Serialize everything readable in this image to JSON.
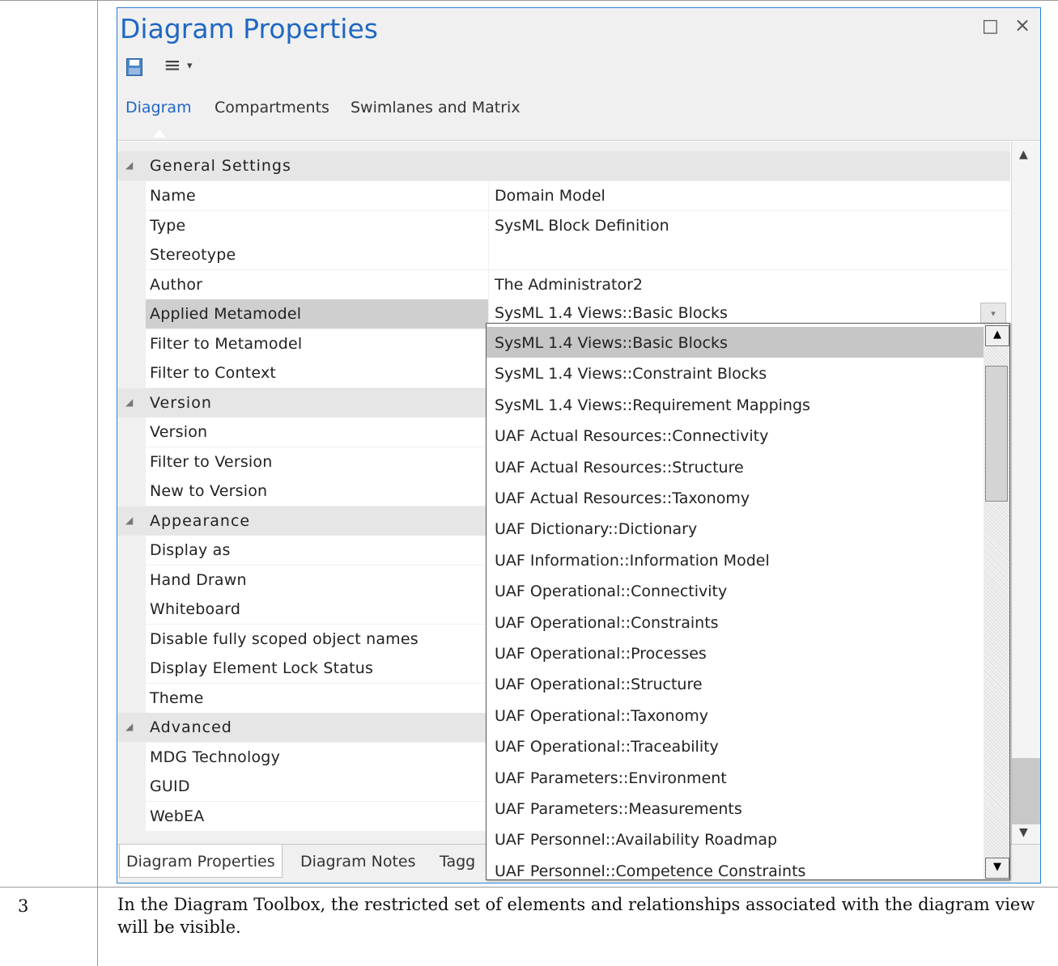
{
  "window": {
    "title": "Diagram Properties",
    "maximize_icon": "□",
    "close_icon": "×",
    "toolbar_menu_icon": "≡",
    "toolbar_caret": "▾"
  },
  "tabs": [
    "Diagram",
    "Compartments",
    "Swimlanes and Matrix"
  ],
  "grid": {
    "categories": {
      "general": "General Settings",
      "version": "Version",
      "appearance": "Appearance",
      "advanced": "Advanced"
    },
    "props": {
      "name": {
        "label": "Name",
        "value": "Domain Model"
      },
      "type": {
        "label": "Type",
        "value": "SysML Block Definition"
      },
      "stereotype": {
        "label": "Stereotype",
        "value": ""
      },
      "author": {
        "label": "Author",
        "value": "The Administrator2"
      },
      "applied_metamodel": {
        "label": "Applied Metamodel",
        "value": "SysML 1.4 Views::Basic Blocks"
      },
      "filter_metamodel": {
        "label": "Filter to Metamodel"
      },
      "filter_context": {
        "label": "Filter to Context"
      },
      "version": {
        "label": "Version"
      },
      "filter_version": {
        "label": "Filter to Version"
      },
      "new_version": {
        "label": "New to Version"
      },
      "display_as": {
        "label": "Display as"
      },
      "hand_drawn": {
        "label": "Hand Drawn"
      },
      "whiteboard": {
        "label": "Whiteboard"
      },
      "disable_scoped": {
        "label": "Disable fully scoped object names"
      },
      "lock_status": {
        "label": "Display Element Lock Status"
      },
      "theme": {
        "label": "Theme"
      },
      "mdg": {
        "label": "MDG Technology"
      },
      "guid": {
        "label": "GUID"
      },
      "webea": {
        "label": "WebEA"
      }
    }
  },
  "dropdown": {
    "options": [
      "SysML 1.4 Views::Basic Blocks",
      "SysML 1.4 Views::Constraint Blocks",
      "SysML 1.4 Views::Requirement Mappings",
      "UAF Actual Resources::Connectivity",
      "UAF Actual Resources::Structure",
      "UAF Actual Resources::Taxonomy",
      "UAF Dictionary::Dictionary",
      "UAF Information::Information Model",
      "UAF Operational::Connectivity",
      "UAF Operational::Constraints",
      "UAF Operational::Processes",
      "UAF Operational::Structure",
      "UAF Operational::Taxonomy",
      "UAF Operational::Traceability",
      "UAF Parameters::Environment",
      "UAF Parameters::Measurements",
      "UAF Personnel::Availability Roadmap",
      "UAF Personnel::Competence Constraints"
    ]
  },
  "bottom_tabs": [
    "Diagram Properties",
    "Diagram Notes",
    "Tagg"
  ],
  "doc": {
    "step": "3",
    "text": "In the Diagram Toolbox, the restricted set of elements and relationships associated with the diagram view will be visible."
  },
  "colors": {
    "accent": "#1f67c4",
    "border": "#2b7fd6",
    "selected": "#cfcfcf"
  }
}
